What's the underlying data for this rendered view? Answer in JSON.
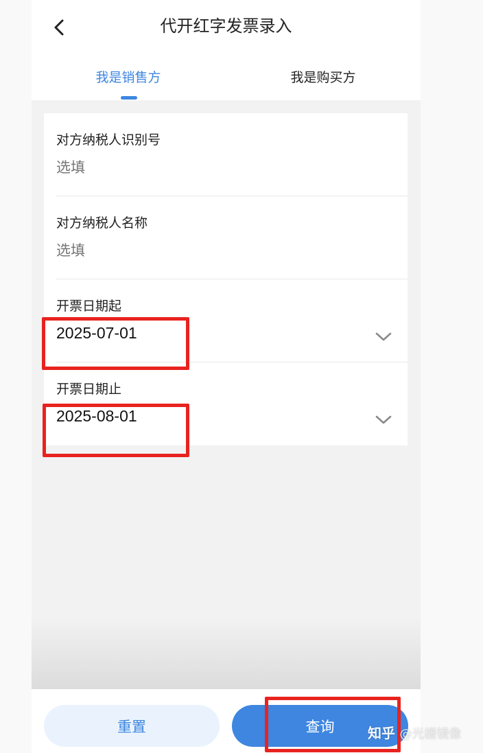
{
  "header": {
    "title": "代开红字发票录入",
    "back_icon": "chevron-left-icon"
  },
  "tabs": [
    {
      "label": "我是销售方",
      "active": true
    },
    {
      "label": "我是购买方",
      "active": false
    }
  ],
  "form": {
    "counterparty_tax_id": {
      "label": "对方纳税人识别号",
      "placeholder": "选填",
      "value": ""
    },
    "counterparty_name": {
      "label": "对方纳税人名称",
      "placeholder": "选填",
      "value": ""
    },
    "invoice_date_start": {
      "label": "开票日期起",
      "value": "2025-07-01",
      "icon": "chevron-down-icon"
    },
    "invoice_date_end": {
      "label": "开票日期止",
      "value": "2025-08-01",
      "icon": "chevron-down-icon"
    }
  },
  "actions": {
    "reset_label": "重置",
    "query_label": "查询"
  },
  "watermark": {
    "brand": "知乎",
    "handle": "@光栅镜像"
  },
  "colors": {
    "accent": "#3e86e0",
    "highlight_box": "#e8231f",
    "reset_button_bg": "#eaf3fd"
  }
}
